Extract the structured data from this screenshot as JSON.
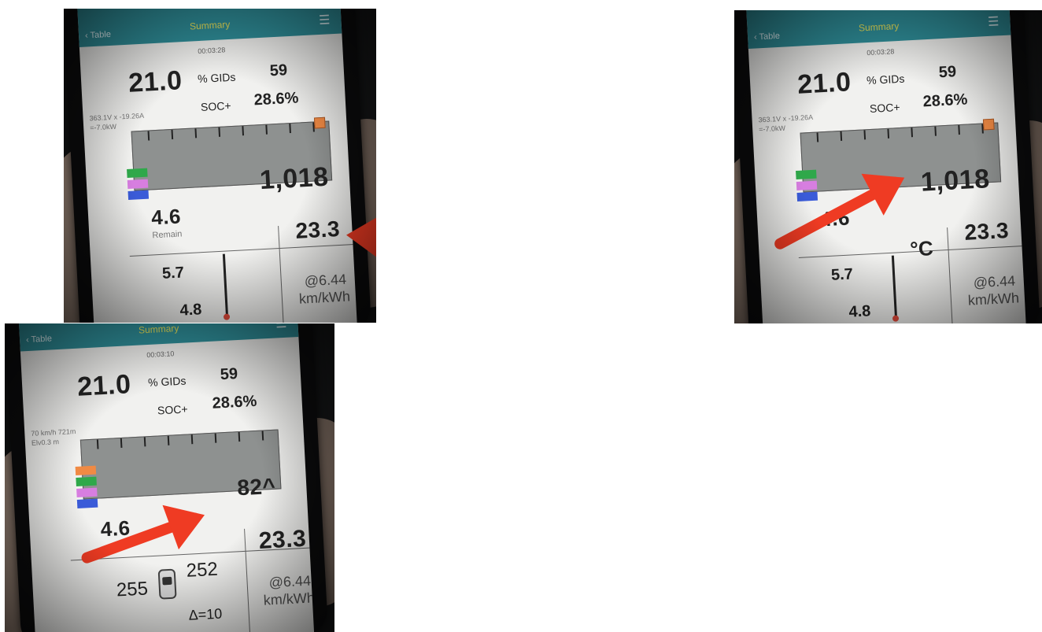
{
  "frames": [
    {
      "nav": {
        "back": "Table",
        "title": "Summary",
        "menu_glyph": "☰"
      },
      "timer": "00:03:28",
      "gids_pct": "21.0",
      "gids_label": "% GIDs",
      "gids_value": "59",
      "soc_label": "SOC+",
      "soc_value": "28.6%",
      "power_line1": "363.1V x -19.26A",
      "power_line2": "=-7.0kW",
      "right_big": "1,018",
      "left_value": "4.6",
      "left_label": "Remain",
      "temp_a": "5.7",
      "temp_b": "4.8",
      "box_value": "23.3",
      "eff_value": "@6.44",
      "eff_unit": "km/kWh"
    },
    {
      "nav": {
        "back": "Table",
        "title": "Summary",
        "menu_glyph": "☰"
      },
      "timer": "00:03:28",
      "gids_pct": "21.0",
      "gids_label": "% GIDs",
      "gids_value": "59",
      "soc_label": "SOC+",
      "soc_value": "28.6%",
      "power_line1": "363.1V x -19.26A",
      "power_line2": "=-7.0kW",
      "right_big": "1,018",
      "left_value": "4.6",
      "temp_unit": "°C",
      "temp_a": "5.7",
      "temp_b": "4.8",
      "box_value": "23.3",
      "eff_value": "@6.44",
      "eff_unit": "km/kWh"
    },
    {
      "nav": {
        "back": "Table",
        "title": "Summary",
        "menu_glyph": "☰"
      },
      "timer": "00:03:10",
      "gids_pct": "21.0",
      "gids_label": "% GIDs",
      "gids_value": "59",
      "soc_label": "SOC+",
      "soc_value": "28.6%",
      "speed_line1": "70 km/h 721m",
      "speed_line2": "Elv0.3 m",
      "right_big": "82^",
      "left_value": "4.6",
      "tire_left": "255",
      "tire_right": "252",
      "delta": "Δ=10",
      "box_value": "23.3",
      "eff_value": "@6.44",
      "eff_unit": "km/kWh"
    }
  ],
  "colors": {
    "arrow": "#ef3b23",
    "nav_bar": "#2f8f9a",
    "nav_title": "#e8e25a",
    "legend": [
      "#f08a44",
      "#2fa84a",
      "#d77ee0",
      "#3a5bd8"
    ]
  }
}
